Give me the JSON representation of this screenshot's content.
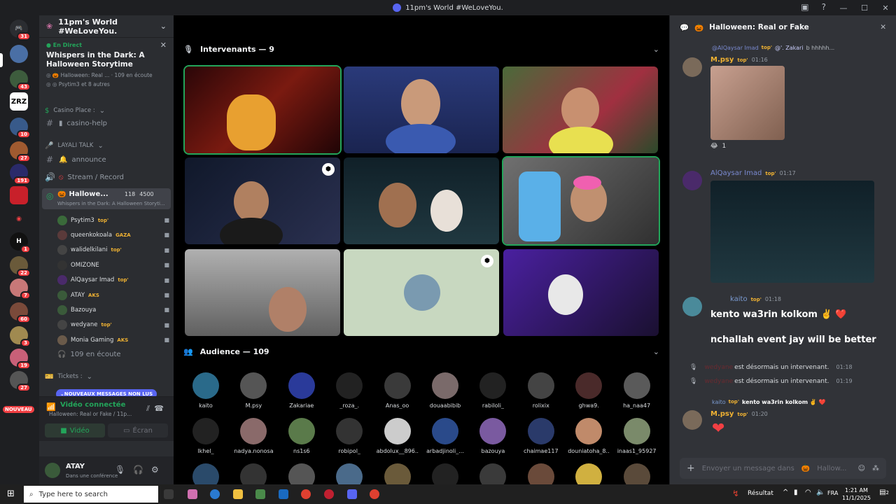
{
  "window": {
    "title": "11pm's World #WeLoveYou."
  },
  "rail": {
    "badges": [
      "31",
      "43",
      "10",
      "27",
      "191",
      "1",
      "22",
      "60",
      "7",
      "60",
      "3",
      "19",
      "27"
    ],
    "server_zrz": "ZRZ",
    "new_label": "NOUVEAU"
  },
  "guild": {
    "name": "11pm's World #WeLoveYou."
  },
  "event": {
    "live": "En Direct",
    "title": "Whispers in the Dark: A Halloween Storytime",
    "channel": "Halloween: Real ...",
    "listeners": "109 en écoute",
    "hosts": "Psytim3 et 8 autres"
  },
  "channels": {
    "cat_casino": "Casino Place :",
    "casino_help": "casino-help",
    "cat_layali": "LAYALI TALK",
    "announce": "announce",
    "stream_record": "Stream / Record",
    "active_voice": "Hallowe...",
    "active_count": "118",
    "active_cap": "4500",
    "active_sub": "Whispers in the Dark: A Halloween Storyti...",
    "members": [
      {
        "name": "Psytim3",
        "tag": "top'"
      },
      {
        "name": "queenkokoala",
        "tag": "GAZA"
      },
      {
        "name": "walidelkilani",
        "tag": "top'"
      },
      {
        "name": "OMIZONE",
        "tag": ""
      },
      {
        "name": "AlQaysar Imad",
        "tag": "top'"
      },
      {
        "name": "ATAY",
        "tag": "AKS"
      },
      {
        "name": "Bazouya",
        "tag": ""
      },
      {
        "name": "wedyane",
        "tag": "top'"
      },
      {
        "name": "Monia Gaming",
        "tag": "AKS"
      }
    ],
    "listening": "109 en écoute",
    "tickets": "Tickets :",
    "new_messages": "NOUVEAUX MESSAGES NON LUS"
  },
  "voice_panel": {
    "status": "Vidéo connectée",
    "sub": "Halloween: Real or Fake / 11p...",
    "video": "Vidéo",
    "screen": "Écran"
  },
  "user": {
    "name": "ATAY",
    "status": "Dans une conférence"
  },
  "stage": {
    "speakers_label": "Intervenants — 9",
    "audience_label": "Audience — 109",
    "audience": [
      "kaito",
      "M.psy",
      "Zakariae",
      "_roza_.",
      "Anas_oo",
      "douaabibib",
      "rabiloli_",
      "rolixix",
      "ghwa9.",
      "ha_naa47",
      "lkhel_",
      "nadya.nonosa",
      "ns1s6",
      "robipol_",
      "abdolux__896...",
      "arbadjinoli_...",
      "bazouya",
      "chaimae117",
      "douniatoha_8...",
      "inaas1_95927"
    ]
  },
  "chat": {
    "title": "Halloween: Real or Fake",
    "reply1": "@AlQaysar Imad",
    "reply1_tag": "top'",
    "reply1_mention": "@'. Zakari",
    "reply1_text": "b hhhhh...",
    "msg1_name": "M.psy",
    "msg1_tag": "top'",
    "msg1_time": "01:16",
    "msg1_reaction": "1",
    "msg2_name": "AlQaysar Imad",
    "msg2_tag": "top'",
    "msg2_time": "01:17",
    "msg3_name": "kaito",
    "msg3_tag": "top'",
    "msg3_time": "01:18",
    "msg3_line1": "kento wa3rin kolkom ✌️ ❤️",
    "msg3_line2": "nchallah event jay will be better",
    "sys1_name": "wedyane",
    "sys1_text": "est désormais un intervenant.",
    "sys1_time": "01:18",
    "sys2_name": "wedyane",
    "sys2_text": "est désormais un intervenant.",
    "sys2_time": "01:19",
    "reply2_name": "kaito",
    "reply2_tag": "top'",
    "reply2_text": "kento wa3rin kolkom ✌️ ❤️",
    "msg4_name": "M.psy",
    "msg4_tag": "top'",
    "msg4_time": "01:20",
    "composer_placeholder": "Envoyer un message dans",
    "composer_channel": "Hallow..."
  },
  "taskbar": {
    "search_placeholder": "Type here to search",
    "result": "Résultat",
    "lang": "FRA",
    "time": "1:21 AM",
    "date": "11/1/2025",
    "notif": "2"
  }
}
